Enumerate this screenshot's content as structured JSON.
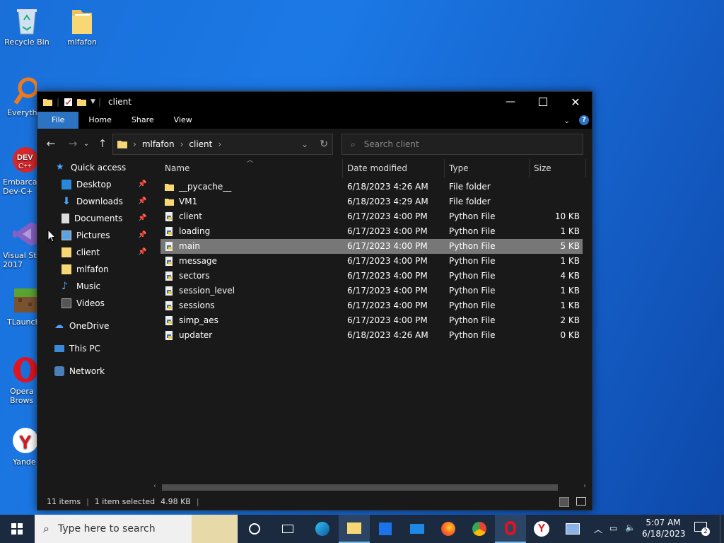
{
  "desktop": {
    "icons": [
      {
        "label": "Recycle Bin"
      },
      {
        "label": "mlfafon"
      },
      {
        "label": "Everyth"
      },
      {
        "label": "Embarca Dev-C+"
      },
      {
        "label": "Visual St 2017"
      },
      {
        "label": "TLaunch"
      },
      {
        "label": "Opera Brows"
      },
      {
        "label": "Yande"
      }
    ]
  },
  "window": {
    "title": "client",
    "ribbon_tabs": [
      "File",
      "Home",
      "Share",
      "View"
    ],
    "address": {
      "crumbs": [
        "mlfafon",
        "client"
      ]
    },
    "search": {
      "placeholder": "Search client"
    },
    "sidebar": {
      "quick_access": "Quick access",
      "items": [
        {
          "label": "Desktop",
          "pinned": true
        },
        {
          "label": "Downloads",
          "pinned": true
        },
        {
          "label": "Documents",
          "pinned": true
        },
        {
          "label": "Pictures",
          "pinned": true
        },
        {
          "label": "client",
          "pinned": true
        },
        {
          "label": "mlfafon",
          "pinned": false
        },
        {
          "label": "Music",
          "pinned": false
        },
        {
          "label": "Videos",
          "pinned": false
        }
      ],
      "onedrive": "OneDrive",
      "this_pc": "This PC",
      "network": "Network"
    },
    "columns": [
      "Name",
      "Date modified",
      "Type",
      "Size"
    ],
    "files": [
      {
        "name": "__pycache__",
        "date": "6/18/2023 4:26 AM",
        "type": "File folder",
        "size": "",
        "kind": "folder"
      },
      {
        "name": "VM1",
        "date": "6/18/2023 4:29 AM",
        "type": "File folder",
        "size": "",
        "kind": "folder"
      },
      {
        "name": "client",
        "date": "6/17/2023 4:00 PM",
        "type": "Python File",
        "size": "10 KB",
        "kind": "py"
      },
      {
        "name": "loading",
        "date": "6/17/2023 4:00 PM",
        "type": "Python File",
        "size": "1 KB",
        "kind": "py"
      },
      {
        "name": "main",
        "date": "6/17/2023 4:00 PM",
        "type": "Python File",
        "size": "5 KB",
        "kind": "py",
        "selected": true
      },
      {
        "name": "message",
        "date": "6/17/2023 4:00 PM",
        "type": "Python File",
        "size": "1 KB",
        "kind": "py"
      },
      {
        "name": "sectors",
        "date": "6/17/2023 4:00 PM",
        "type": "Python File",
        "size": "4 KB",
        "kind": "py"
      },
      {
        "name": "session_level",
        "date": "6/17/2023 4:00 PM",
        "type": "Python File",
        "size": "1 KB",
        "kind": "py"
      },
      {
        "name": "sessions",
        "date": "6/17/2023 4:00 PM",
        "type": "Python File",
        "size": "1 KB",
        "kind": "py"
      },
      {
        "name": "simp_aes",
        "date": "6/17/2023 4:00 PM",
        "type": "Python File",
        "size": "2 KB",
        "kind": "py"
      },
      {
        "name": "updater",
        "date": "6/18/2023 4:26 AM",
        "type": "Python File",
        "size": "0 KB",
        "kind": "py"
      }
    ],
    "status": {
      "items": "11 items",
      "selected": "1 item selected",
      "size": "4.98 KB"
    }
  },
  "taskbar": {
    "search_placeholder": "Type here to search",
    "time": "5:07 AM",
    "date": "6/18/2023",
    "notifications": "2"
  },
  "colors": {
    "accent": "#2c73c4",
    "selected_row": "#777777",
    "folder": "#f8d775"
  }
}
